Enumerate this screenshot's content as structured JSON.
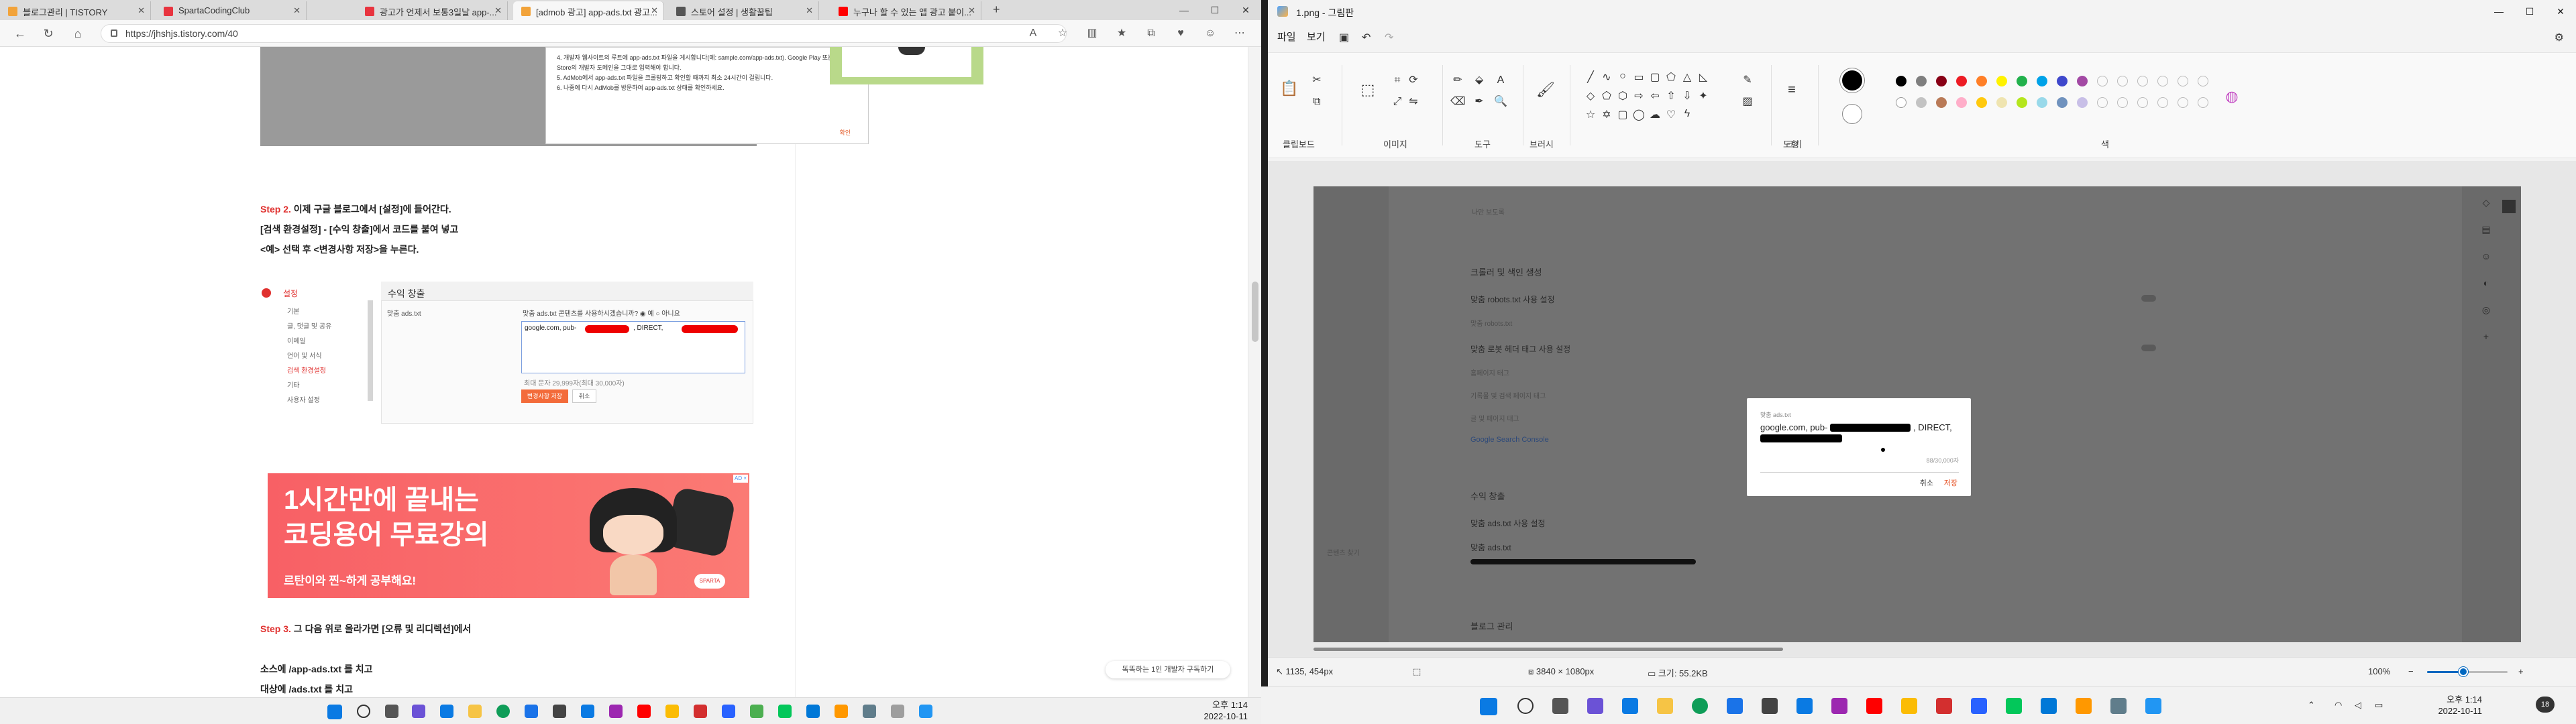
{
  "browser": {
    "tabs": [
      {
        "label": "블로그관리 | TISTORY",
        "color": "#f2a33a"
      },
      {
        "label": "SpartaCodingClub",
        "color": "#e8343f"
      },
      {
        "label": "광고가 언제서 보통3일날 app-...",
        "color": "#e8343f"
      },
      {
        "label": "[admob 광고] app-ads.txt 광고...",
        "color": "#f2a33a"
      },
      {
        "label": "스토어 설정 | 생활꿀팁",
        "color": "#555555"
      },
      {
        "label": "누구나 할 수 있는 앱 광고 붙이...",
        "color": "#ff0000"
      }
    ],
    "new_tab": "+",
    "url": "https://jhshjs.tistory.com/40",
    "page": {
      "dialog1_lines": [
        "4. 개발자 웹사이트의 루트에 app-ads.txt 파일을 게시합니다(예: sample.com/app-ads.txt). Google Play 또는 App Store의 개발자 도메인을 그대로 입력해야 합니다.",
        "5. AdMob에서 app-ads.txt 파일을 크롤링하고 확인할 때까지 최소 24시간이 걸립니다.",
        "6. 나중에 다시 AdMob를 방문하여 app-ads.txt 상태를 확인하세요."
      ],
      "dialog1_ok": "확인",
      "step2_prefix": "Step 2.",
      "step2_text": " 이제 구글 블로그에서 [설정]에 들어간다.",
      "step2_line2": "[검색 환경설정] - [수익 창출]에서 코드를 붙여 넣고",
      "step2_line3": "<예> 선택 후 <변경사항 저장>을 누른다.",
      "shot2": {
        "settings": "설정",
        "menu": [
          "기본",
          "글, 댓글 및 공유",
          "이메일",
          "언어 및 서식",
          "검색 환경설정",
          "기타",
          "사용자 설정"
        ],
        "section": "수익 창출",
        "custom_label": "맞춤 ads.txt",
        "radio": "맞춤 ads.txt 콘텐츠를 사용하시겠습니까?  ◉ 예  ○ 아니요",
        "code_prefix": "google.com, pub-",
        "code_mid": ", DIRECT, ",
        "count": "최대 문자 29,999자(최대 30,000자)",
        "save": "변경사항 저장",
        "cancel": "취소"
      },
      "banner_line1": "1시간만에 끝내는",
      "banner_line2": "코딩용어 무료강의",
      "banner_sub": "르탄이와 찐~하게 공부해요!",
      "banner_badge": "SPARTA",
      "banner_ad": "AD ×",
      "step3_prefix": "Step 3.",
      "step3_text": " 그 다음 위로 올라가면 [오류 및 리디렉션]에서",
      "line_a": "소스에 /app-ads.txt 를 치고",
      "line_b": "대상에 /ads.txt 를 치고",
      "float_button": "똑똑하는 1인 개발자 구독하기"
    }
  },
  "paint": {
    "title": "1.png - 그림판",
    "menu": [
      "파일",
      "보기"
    ],
    "groups": [
      "클립보드",
      "이미지",
      "도구",
      "브러시",
      "도형",
      "크기",
      "색"
    ],
    "palette_row1": [
      "#000000",
      "#7f7f7f",
      "#880015",
      "#ed1c24",
      "#ff7f27",
      "#fff200",
      "#22b14c",
      "#00a2e8",
      "#3f48cc",
      "#a349a4"
    ],
    "palette_row2": [
      "#ffffff",
      "#c3c3c3",
      "#b97a57",
      "#ffaec9",
      "#ffc90e",
      "#efe4b0",
      "#b5e61d",
      "#99d9ea",
      "#7092be",
      "#c8bfe7"
    ],
    "image": {
      "top_text": "나만 보도록",
      "crawl_header": "크롤러 및 색인 생성",
      "robots": "맞춤 robots.txt 사용 설정",
      "robots_sub": "맞춤 robots.txt",
      "header_tags": "맞춤 로봇 헤더 태그 사용 설정",
      "home_tags": "홈페이지 태그",
      "archive_tags": "기록물 및 검색 페이지 태그",
      "post_tags": "글 및 페이지 태그",
      "search_console": "Google Search Console",
      "monetize": "수익 창출",
      "ads_enable": "맞춤 ads.txt 사용 설정",
      "ads_label": "맞춤 ads.txt",
      "blog_mgmt": "블로그 관리",
      "left_label": "콘텐츠 찾기",
      "dialog": {
        "label": "맞춤 ads.txt",
        "text_prefix": "google.com, pub-",
        "text_suffix": ", DIRECT,",
        "count": "88/30,000자",
        "cancel": "취소",
        "save": "저장"
      }
    },
    "status": {
      "cursor": "1135, 454px",
      "dimensions": "3840 × 1080px",
      "size": "크기: 55.2KB",
      "zoom": "100%",
      "zoom_fraction": 0.45
    }
  },
  "taskbar": {
    "clock_left_time": "오후 1:14",
    "clock_left_date": "2022-10-11",
    "clock_right_time": "오후 1:14",
    "clock_right_date": "2022-10-11",
    "notif": "18"
  }
}
